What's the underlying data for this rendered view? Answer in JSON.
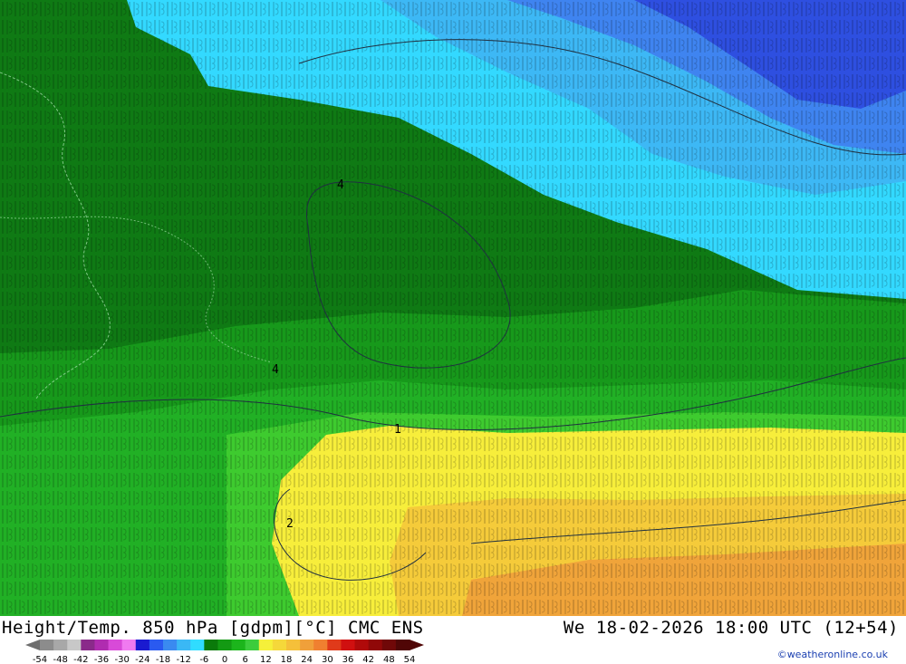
{
  "map": {
    "units": "°C",
    "contour_labels": [
      "1",
      "2",
      "4"
    ],
    "colors": {
      "dark_green": "#0f7a14",
      "mid_green": "#17991b",
      "green": "#21b025",
      "light_green": "#3ecb2f",
      "yellow": "#f7ee3b",
      "gold": "#f5cb3a",
      "orange": "#f0a43a",
      "cyan": "#33d9ff",
      "light_blue": "#3db8f5",
      "blue": "#3f84f0",
      "dark_blue": "#2e4fe0"
    }
  },
  "footer": {
    "title": "Height/Temp. 850 hPa [gdpm][°C] CMC ENS",
    "datetime": "We 18-02-2026 18:00 UTC (12+54)",
    "credit": "©weatheronline.co.uk"
  },
  "legend": {
    "ticks": [
      "-54",
      "-48",
      "-42",
      "-36",
      "-30",
      "-24",
      "-18",
      "-12",
      "-6",
      "0",
      "6",
      "12",
      "18",
      "24",
      "30",
      "36",
      "42",
      "48",
      "54"
    ],
    "colors": [
      "#8c8c8c",
      "#a8a8a8",
      "#c8c8c8",
      "#8a2a8a",
      "#b02cb0",
      "#d84ad8",
      "#f07af0",
      "#1a1ad0",
      "#2a5af0",
      "#3a8af0",
      "#3ab8f5",
      "#30dcff",
      "#0a7a0a",
      "#139a13",
      "#1cb51c",
      "#3ccc3c",
      "#f5f03a",
      "#f5d83a",
      "#f5c03a",
      "#f0a03a",
      "#f08030",
      "#e03a1a",
      "#d01010",
      "#b00a0a",
      "#900808",
      "#700808",
      "#500606"
    ]
  }
}
